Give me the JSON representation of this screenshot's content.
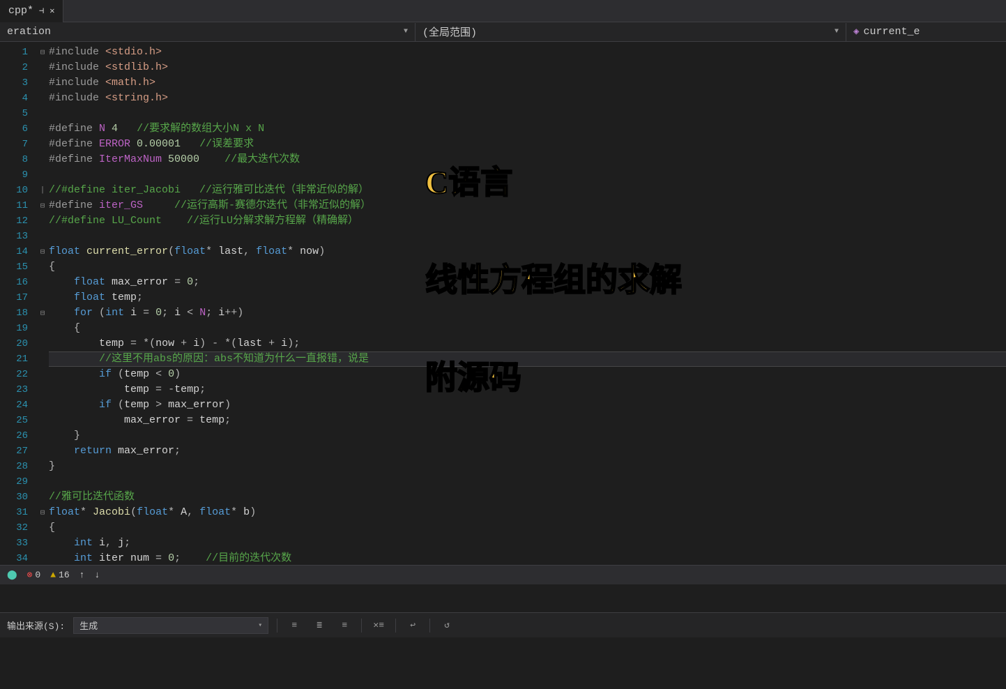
{
  "tab": {
    "name": "cpp*",
    "pinned": true
  },
  "nav": {
    "scope1": "eration",
    "scope2": "(全局范围)",
    "member": "current_e"
  },
  "overlay": {
    "line1": "C语言",
    "line2": "线性方程组的求解",
    "line3": "附源码"
  },
  "status": {
    "errors": "0",
    "warnings": "16"
  },
  "output": {
    "label": "输出来源(S):",
    "source": "生成"
  },
  "code": {
    "lines": [
      [
        [
          "pp",
          "#include "
        ],
        [
          "str",
          "<stdio.h>"
        ]
      ],
      [
        [
          "pp",
          "#include "
        ],
        [
          "str",
          "<stdlib.h>"
        ]
      ],
      [
        [
          "pp",
          "#include "
        ],
        [
          "str",
          "<math.h>"
        ]
      ],
      [
        [
          "pp",
          "#include "
        ],
        [
          "str",
          "<string.h>"
        ]
      ],
      [],
      [
        [
          "pp",
          "#define "
        ],
        [
          "mac",
          "N"
        ],
        [
          "id",
          " "
        ],
        [
          "num",
          "4"
        ],
        [
          "id",
          "   "
        ],
        [
          "cmt",
          "//要求解的数组大小N x N"
        ]
      ],
      [
        [
          "pp",
          "#define "
        ],
        [
          "mac",
          "ERROR"
        ],
        [
          "id",
          " "
        ],
        [
          "num",
          "0.00001"
        ],
        [
          "id",
          "   "
        ],
        [
          "cmt",
          "//误差要求"
        ]
      ],
      [
        [
          "pp",
          "#define "
        ],
        [
          "mac",
          "IterMaxNum"
        ],
        [
          "id",
          " "
        ],
        [
          "num",
          "50000"
        ],
        [
          "id",
          "    "
        ],
        [
          "cmt",
          "//最大迭代次数"
        ]
      ],
      [],
      [
        [
          "cmt",
          "//#define iter_Jacobi   //运行雅可比迭代（非常近似的解）"
        ]
      ],
      [
        [
          "pp",
          "#define "
        ],
        [
          "mac",
          "iter_GS"
        ],
        [
          "id",
          "     "
        ],
        [
          "cmt",
          "//运行高斯-赛德尔迭代（非常近似的解）"
        ]
      ],
      [
        [
          "cmt",
          "//#define LU_Count    //运行LU分解求解方程解（精确解）"
        ]
      ],
      [],
      [
        [
          "type",
          "float"
        ],
        [
          "id",
          " "
        ],
        [
          "fn",
          "current_error"
        ],
        [
          "op",
          "("
        ],
        [
          "type",
          "float"
        ],
        [
          "op",
          "*"
        ],
        [
          "id",
          " last"
        ],
        [
          "op",
          ", "
        ],
        [
          "type",
          "float"
        ],
        [
          "op",
          "*"
        ],
        [
          "id",
          " now"
        ],
        [
          "op",
          ")"
        ]
      ],
      [
        [
          "op",
          "{"
        ]
      ],
      [
        [
          "id",
          "    "
        ],
        [
          "type",
          "float"
        ],
        [
          "id",
          " max_error "
        ],
        [
          "op",
          "="
        ],
        [
          "id",
          " "
        ],
        [
          "num",
          "0"
        ],
        [
          "op",
          ";"
        ]
      ],
      [
        [
          "id",
          "    "
        ],
        [
          "type",
          "float"
        ],
        [
          "id",
          " temp"
        ],
        [
          "op",
          ";"
        ]
      ],
      [
        [
          "id",
          "    "
        ],
        [
          "kw",
          "for"
        ],
        [
          "id",
          " "
        ],
        [
          "op",
          "("
        ],
        [
          "type",
          "int"
        ],
        [
          "id",
          " i "
        ],
        [
          "op",
          "="
        ],
        [
          "id",
          " "
        ],
        [
          "num",
          "0"
        ],
        [
          "op",
          ";"
        ],
        [
          "id",
          " i "
        ],
        [
          "op",
          "<"
        ],
        [
          "id",
          " "
        ],
        [
          "mac",
          "N"
        ],
        [
          "op",
          ";"
        ],
        [
          "id",
          " i"
        ],
        [
          "op",
          "++)"
        ]
      ],
      [
        [
          "id",
          "    "
        ],
        [
          "op",
          "{"
        ]
      ],
      [
        [
          "id",
          "        temp "
        ],
        [
          "op",
          "="
        ],
        [
          "id",
          " "
        ],
        [
          "op",
          "*("
        ],
        [
          "id",
          "now "
        ],
        [
          "op",
          "+"
        ],
        [
          "id",
          " i"
        ],
        [
          "op",
          ") - *("
        ],
        [
          "id",
          "last "
        ],
        [
          "op",
          "+"
        ],
        [
          "id",
          " i"
        ],
        [
          "op",
          ");"
        ]
      ],
      [
        [
          "id",
          "        "
        ],
        [
          "cmt",
          "//这里不用abs的原因：abs不知道为什么一直报错，说是"
        ]
      ],
      [
        [
          "id",
          "        "
        ],
        [
          "kw",
          "if"
        ],
        [
          "id",
          " "
        ],
        [
          "op",
          "("
        ],
        [
          "id",
          "temp "
        ],
        [
          "op",
          "<"
        ],
        [
          "id",
          " "
        ],
        [
          "num",
          "0"
        ],
        [
          "op",
          ")"
        ]
      ],
      [
        [
          "id",
          "            temp "
        ],
        [
          "op",
          "="
        ],
        [
          "id",
          " "
        ],
        [
          "op",
          "-"
        ],
        [
          "id",
          "temp"
        ],
        [
          "op",
          ";"
        ]
      ],
      [
        [
          "id",
          "        "
        ],
        [
          "kw",
          "if"
        ],
        [
          "id",
          " "
        ],
        [
          "op",
          "("
        ],
        [
          "id",
          "temp "
        ],
        [
          "op",
          ">"
        ],
        [
          "id",
          " max_error"
        ],
        [
          "op",
          ")"
        ]
      ],
      [
        [
          "id",
          "            max_error "
        ],
        [
          "op",
          "="
        ],
        [
          "id",
          " temp"
        ],
        [
          "op",
          ";"
        ]
      ],
      [
        [
          "id",
          "    "
        ],
        [
          "op",
          "}"
        ]
      ],
      [
        [
          "id",
          "    "
        ],
        [
          "kw",
          "return"
        ],
        [
          "id",
          " max_error"
        ],
        [
          "op",
          ";"
        ]
      ],
      [
        [
          "op",
          "}"
        ]
      ],
      [],
      [
        [
          "cmt",
          "//雅可比迭代函数"
        ]
      ],
      [
        [
          "type",
          "float"
        ],
        [
          "op",
          "*"
        ],
        [
          "id",
          " "
        ],
        [
          "fn",
          "Jacobi"
        ],
        [
          "op",
          "("
        ],
        [
          "type",
          "float"
        ],
        [
          "op",
          "*"
        ],
        [
          "id",
          " A"
        ],
        [
          "op",
          ", "
        ],
        [
          "type",
          "float"
        ],
        [
          "op",
          "*"
        ],
        [
          "id",
          " b"
        ],
        [
          "op",
          ")"
        ]
      ],
      [
        [
          "op",
          "{"
        ]
      ],
      [
        [
          "id",
          "    "
        ],
        [
          "type",
          "int"
        ],
        [
          "id",
          " i"
        ],
        [
          "op",
          ","
        ],
        [
          "id",
          " j"
        ],
        [
          "op",
          ";"
        ]
      ],
      [
        [
          "id",
          "    "
        ],
        [
          "type",
          "int"
        ],
        [
          "id",
          " iter num "
        ],
        [
          "op",
          "="
        ],
        [
          "id",
          " "
        ],
        [
          "num",
          "0"
        ],
        [
          "op",
          ";"
        ],
        [
          "id",
          "    "
        ],
        [
          "cmt",
          "//目前的迭代次数"
        ]
      ]
    ]
  },
  "highlight_line": 21,
  "folds": {
    "1": "⊟",
    "10": "|",
    "11": "⊟",
    "14": "⊟",
    "18": "⊟",
    "31": "⊟"
  }
}
